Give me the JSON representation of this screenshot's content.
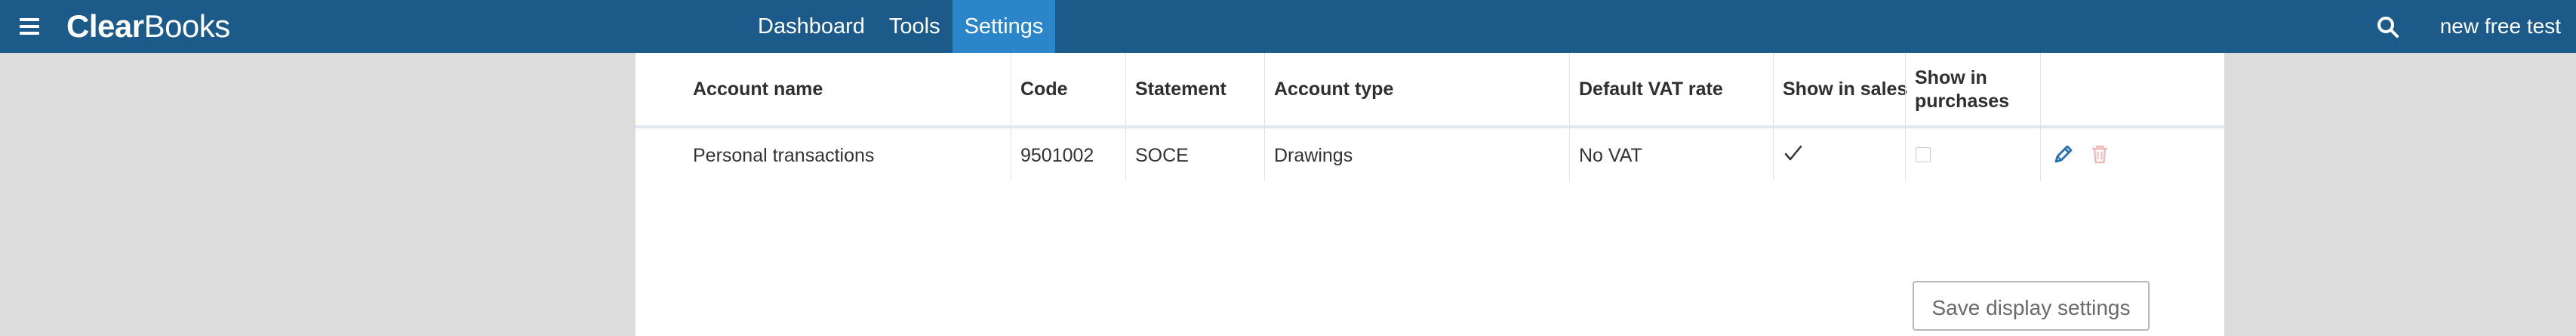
{
  "header": {
    "menu_icon": "hamburger-menu-icon",
    "logo": {
      "part1": "Clear",
      "part2": "Books"
    },
    "nav": [
      {
        "label": "Dashboard",
        "active": false
      },
      {
        "label": "Tools",
        "active": false
      },
      {
        "label": "Settings",
        "active": true
      }
    ],
    "search_icon": "search-icon",
    "user": "new free test"
  },
  "table": {
    "columns": [
      "Account name",
      "Code",
      "Statement",
      "Account type",
      "Default VAT rate",
      "Show in sales",
      "Show in purchases"
    ],
    "rows": [
      {
        "account_name": "Personal transactions",
        "code": "9501002",
        "statement": "SOCE",
        "account_type": "Drawings",
        "vat_rate": "No VAT",
        "show_in_sales": true,
        "show_in_purchases": false
      }
    ]
  },
  "actions": {
    "edit_icon": "pencil-icon",
    "delete_icon": "trash-icon"
  },
  "save_button": "Save display settings",
  "colors": {
    "topbar": "#1c5a8a",
    "active_tab": "#2b86c9",
    "edit": "#2270b4",
    "delete": "#f2b7b7"
  }
}
